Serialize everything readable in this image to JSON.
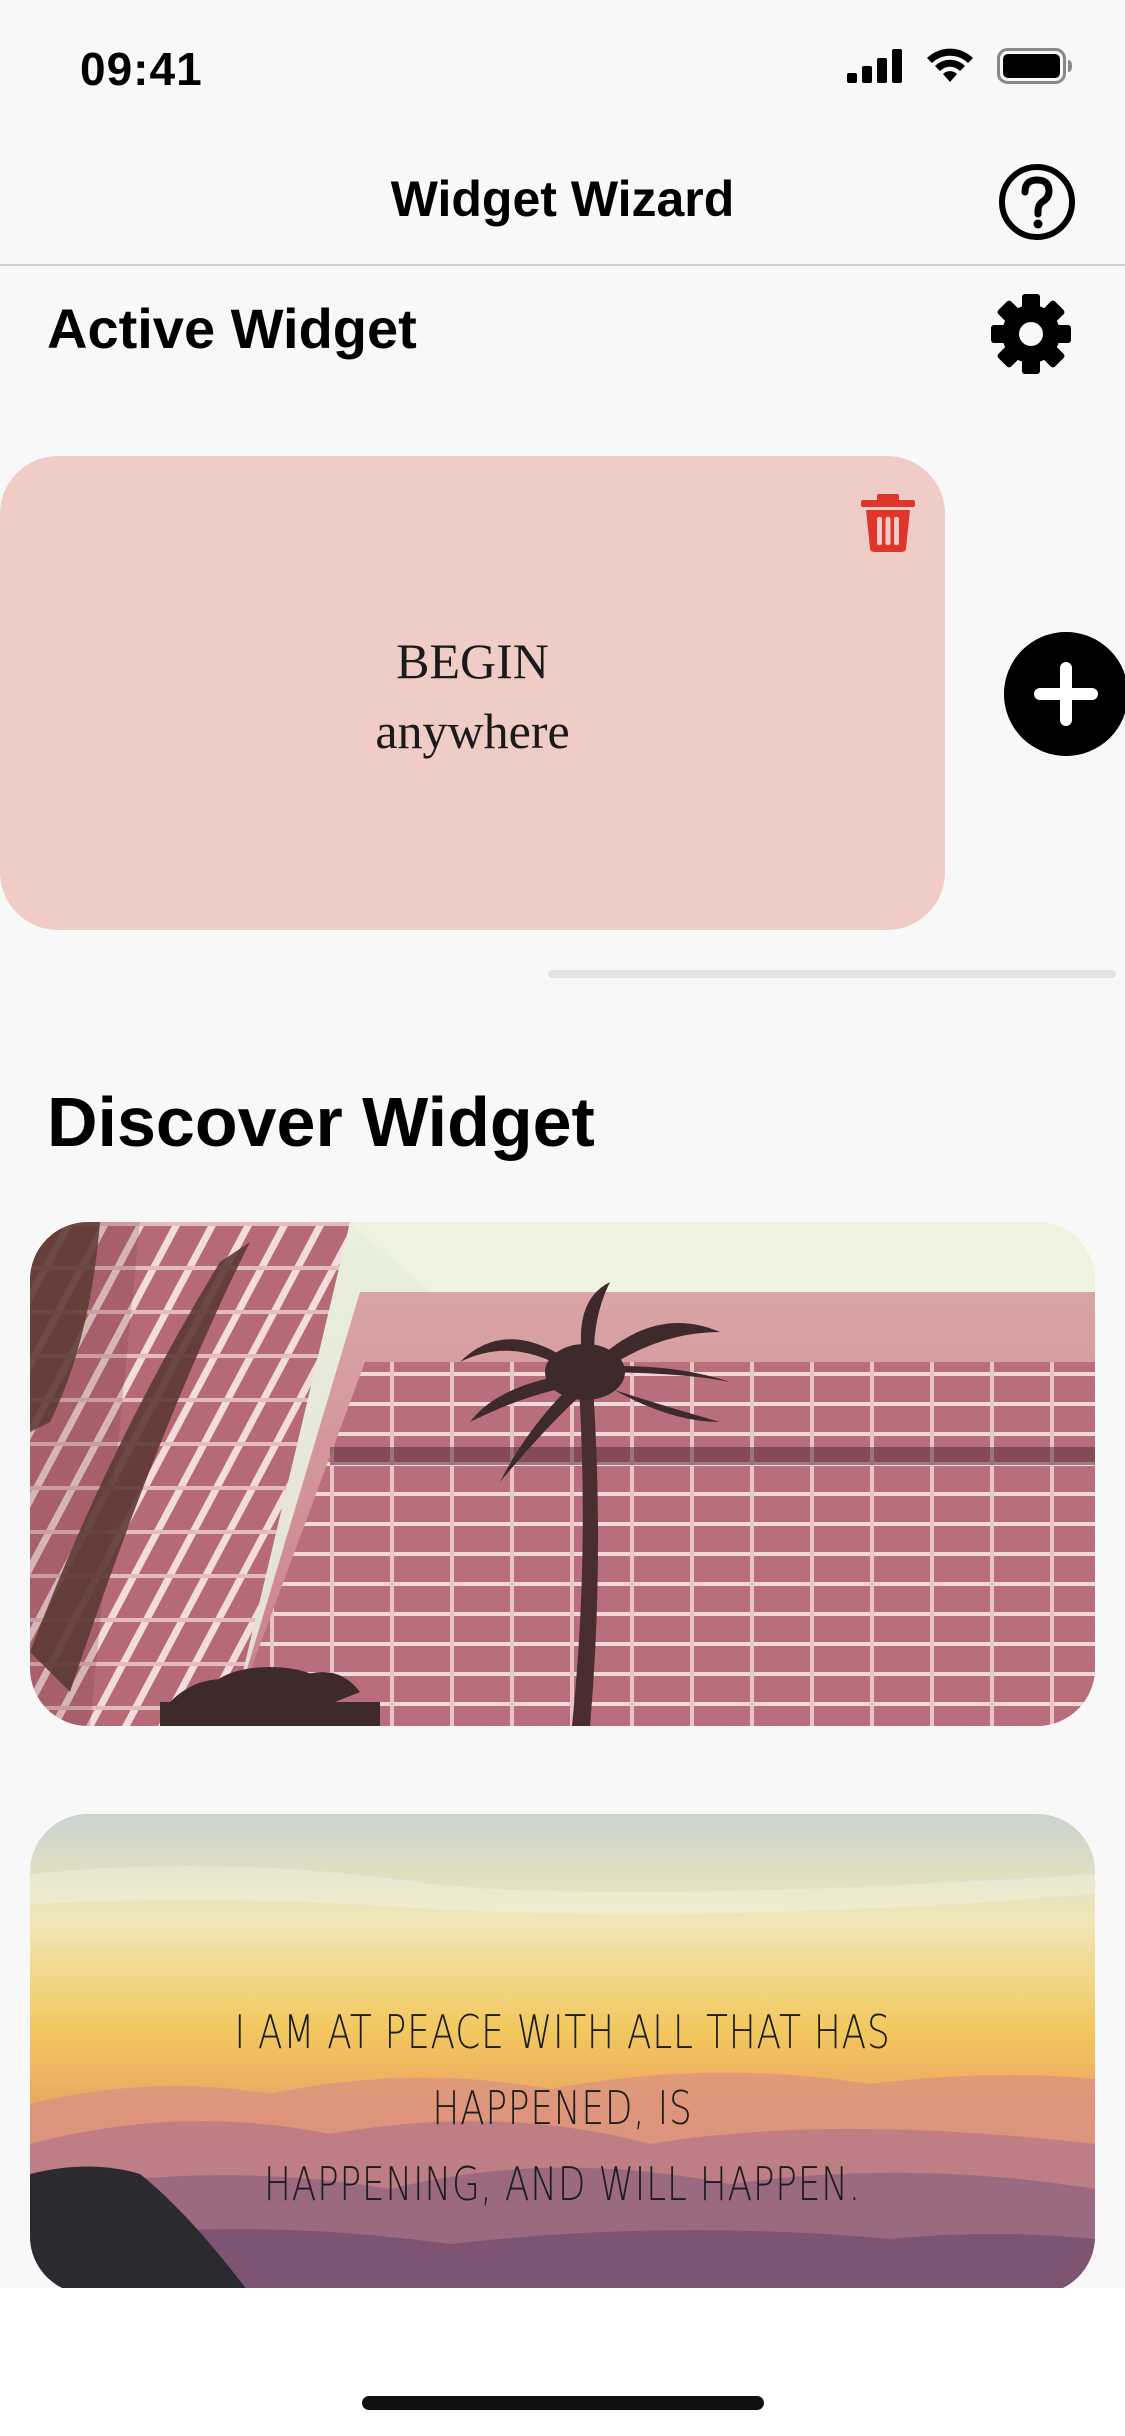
{
  "status_bar": {
    "time": "09:41"
  },
  "nav": {
    "title": "Widget Wizard"
  },
  "active_section": {
    "title": "Active Widget",
    "widget": {
      "line1": "BEGIN",
      "line2": "anywhere",
      "background": "#efccc5"
    }
  },
  "discover_section": {
    "title": "Discover Widget",
    "cards": [
      {
        "description": ""
      },
      {
        "quote_line1": "I AM AT PEACE WITH ALL THAT HAS HAPPENED, IS",
        "quote_line2": "HAPPENING, AND WILL HAPPEN."
      }
    ]
  },
  "colors": {
    "accent": "#000000",
    "delete": "#e0352b",
    "card_pink": "#efccc5",
    "background": "#f8f8f8"
  }
}
